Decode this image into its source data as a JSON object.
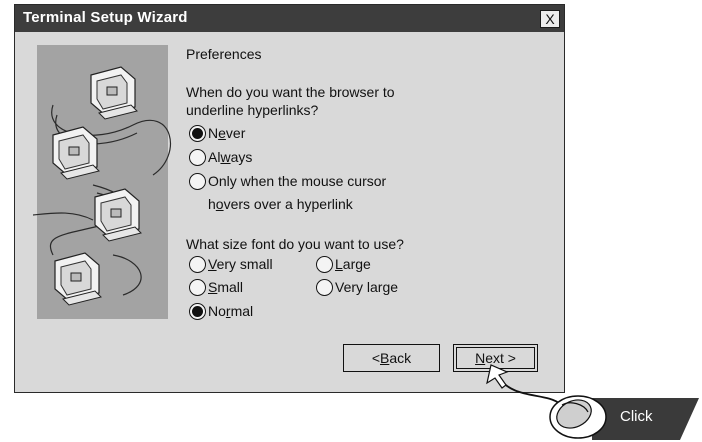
{
  "window": {
    "title": "Terminal Setup Wizard",
    "close_label": "X"
  },
  "section_title": "Preferences",
  "question_underline": {
    "line1": "When do you want the browser to",
    "line2": "underline hyperlinks?",
    "options": [
      {
        "pre": "N",
        "ul": "e",
        "post": "ver",
        "selected": true
      },
      {
        "pre": "Al",
        "ul": "w",
        "post": "ays",
        "selected": false
      },
      {
        "pre": "",
        "ul": "",
        "post": "Only when the mouse cursor",
        "selected": false,
        "line2_pre": "h",
        "line2_ul": "o",
        "line2_post": "vers over a hyperlink"
      }
    ]
  },
  "question_font": {
    "text": "What size font do you want to use?",
    "options": [
      {
        "pre": "",
        "ul": "V",
        "post": "ery small",
        "selected": false
      },
      {
        "pre": "",
        "ul": "L",
        "post": "arge",
        "selected": false
      },
      {
        "pre": "",
        "ul": "S",
        "post": "mall",
        "selected": false
      },
      {
        "pre": "Very lar",
        "ul": "g",
        "post": "e",
        "selected": false
      },
      {
        "pre": "No",
        "ul": "r",
        "post": "mal",
        "selected": true
      }
    ]
  },
  "buttons": {
    "back": {
      "pre": "< ",
      "ul": "B",
      "post": "ack"
    },
    "next": {
      "pre": "",
      "ul": "N",
      "post": "ext >"
    }
  },
  "callout": {
    "label": "Click",
    "icon": "mouse-icon"
  },
  "colors": {
    "titlebar": "#3d3d3d",
    "dialog_bg": "#d9d9d9",
    "illustration_bg": "#a3a3a3",
    "callout_bg": "#3a3a3a"
  }
}
